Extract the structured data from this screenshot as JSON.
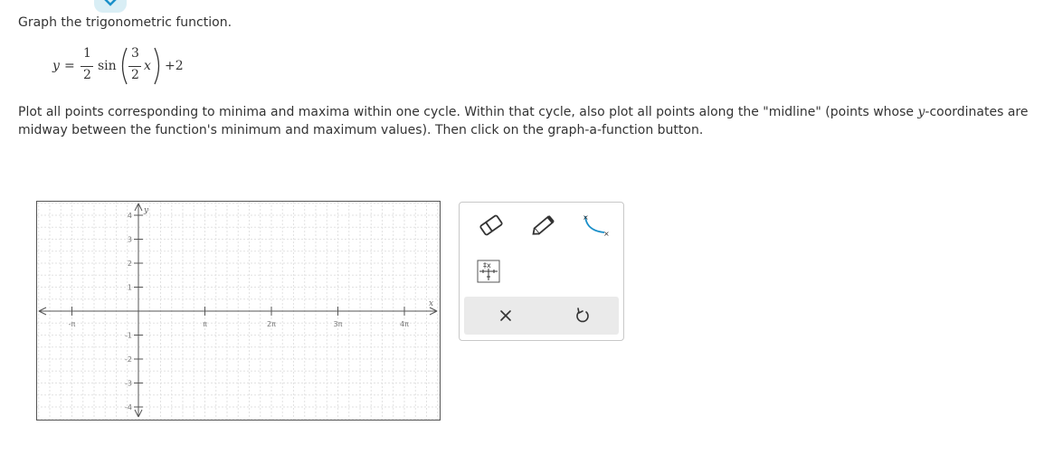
{
  "prompt": "Graph the trigonometric function.",
  "equation": {
    "lhs": "y",
    "equals": "=",
    "coef_num": "1",
    "coef_den": "2",
    "func": "sin",
    "inner_num": "3",
    "inner_den": "2",
    "inner_var": "x",
    "shift": "+2"
  },
  "instructions": {
    "part1": "Plot all points corresponding to minima and maxima within one cycle. Within that cycle, also plot all points along the \"midline\" (points whose ",
    "yvar": "y",
    "part2": "-coordinates are midway between the function's minimum and maximum values). Then click on the graph-a-function button."
  },
  "graph": {
    "x_axis_label": "x",
    "y_axis_label": "y",
    "x_ticks": [
      "-π",
      "π",
      "2π",
      "3π",
      "4π"
    ],
    "y_ticks_pos": [
      "4",
      "3",
      "2",
      "1"
    ],
    "y_ticks_neg": [
      "-1",
      "-2",
      "-3",
      "-4"
    ],
    "grid_color": "#e2e2e2",
    "axis_color": "#555555"
  },
  "tools": {
    "eraser": "eraser-icon",
    "pencil": "pencil-icon",
    "function_graph": "graph-function-icon",
    "table": "table-icon",
    "clear": "×",
    "undo": "↺"
  }
}
